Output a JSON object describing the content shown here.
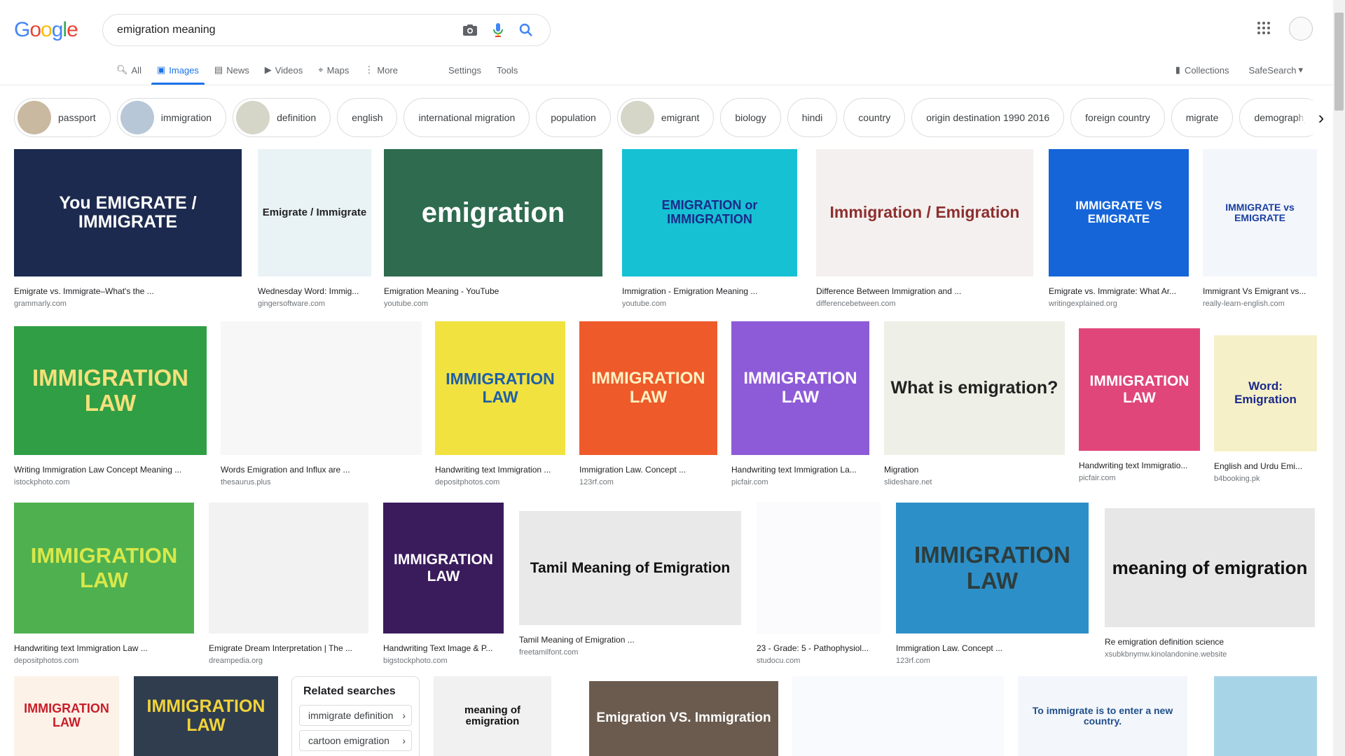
{
  "search": {
    "query": "emigration meaning"
  },
  "logo": {
    "text": "Google"
  },
  "tabs": [
    {
      "label": "All",
      "icon": "search-icon"
    },
    {
      "label": "Images",
      "icon": "image-icon",
      "active": true
    },
    {
      "label": "News",
      "icon": "news-icon"
    },
    {
      "label": "Videos",
      "icon": "video-icon"
    },
    {
      "label": "Maps",
      "icon": "map-icon"
    },
    {
      "label": "More",
      "icon": "more-vert-icon"
    }
  ],
  "tab_extras": [
    "Settings",
    "Tools"
  ],
  "right_tools": {
    "collections": "Collections",
    "safesearch": "SafeSearch"
  },
  "chips": [
    {
      "label": "passport",
      "thumb": true
    },
    {
      "label": "immigration",
      "thumb": true
    },
    {
      "label": "definition",
      "thumb": true
    },
    {
      "label": "english",
      "thumb": false
    },
    {
      "label": "international migration",
      "thumb": false
    },
    {
      "label": "population",
      "thumb": false
    },
    {
      "label": "emigrant",
      "thumb": true
    },
    {
      "label": "biology",
      "thumb": false
    },
    {
      "label": "hindi",
      "thumb": false
    },
    {
      "label": "country",
      "thumb": false
    },
    {
      "label": "origin destination 1990 2016",
      "thumb": false
    },
    {
      "label": "foreign country",
      "thumb": false
    },
    {
      "label": "migrate",
      "thumb": false
    },
    {
      "label": "demography",
      "thumb": false
    }
  ],
  "results": [
    {
      "caption": "Emigrate vs. Immigrate–What's the ...",
      "source": "grammarly.com",
      "text": "You EMIGRATE / IMMIGRATE",
      "bg": "#1d2a4f",
      "fg": "#ffffff"
    },
    {
      "caption": "Wednesday Word: Immig...",
      "source": "gingersoftware.com",
      "text": "Emigrate / Immigrate",
      "bg": "#e9f3f6",
      "fg": "#222222"
    },
    {
      "caption": "Emigration Meaning - YouTube",
      "source": "youtube.com",
      "text": "emigration",
      "bg": "#2e6b4f",
      "fg": "#ffffff"
    },
    {
      "caption": "Immigration - Emigration Meaning ...",
      "source": "youtube.com",
      "text": "EMIGRATION or IMMIGRATION",
      "bg": "#16c1d3",
      "fg": "#1a2a8a"
    },
    {
      "caption": "Difference Between Immigration and ...",
      "source": "differencebetween.com",
      "text": "Immigration / Emigration",
      "bg": "#f4f0ef",
      "fg": "#8c2f2f"
    },
    {
      "caption": "Emigrate vs. Immigrate: What Ar...",
      "source": "writingexplained.org",
      "text": "IMMIGRATE VS EMIGRATE",
      "bg": "#1565d8",
      "fg": "#ffffff"
    },
    {
      "caption": "Immigrant Vs Emigrant vs...",
      "source": "really-learn-english.com",
      "text": "IMMIGRATE vs EMIGRATE",
      "bg": "#f3f6fb",
      "fg": "#1a3fa0"
    },
    {
      "caption": "Writing Immigration Law Concept Meaning ...",
      "source": "istockphoto.com",
      "text": "IMMIGRATION LAW",
      "bg": "#2f9e45",
      "fg": "#f5e07a"
    },
    {
      "caption": "Words Emigration and Influx are ...",
      "source": "thesaurus.plus",
      "text": "",
      "bg": "#f7f7f7",
      "fg": "#333333"
    },
    {
      "caption": "Handwriting text Immigration ...",
      "source": "depositphotos.com",
      "text": "IMMIGRATION LAW",
      "bg": "#f1e23f",
      "fg": "#1d5fa7"
    },
    {
      "caption": "Immigration Law. Concept ...",
      "source": "123rf.com",
      "text": "IMMIGRATION LAW",
      "bg": "#ef5a2b",
      "fg": "#fff3c4"
    },
    {
      "caption": "Handwriting text Immigration La...",
      "source": "picfair.com",
      "text": "IMMIGRATION LAW",
      "bg": "#8e5bd8",
      "fg": "#ffffff"
    },
    {
      "caption": "Migration",
      "source": "slideshare.net",
      "text": "What is emigration?",
      "bg": "#eeefe6",
      "fg": "#222222"
    },
    {
      "caption": "Handwriting text Immigratio...",
      "source": "picfair.com",
      "text": "IMMIGRATION LAW",
      "bg": "#e0467a",
      "fg": "#ffffff"
    },
    {
      "caption": "English and Urdu Emi...",
      "source": "b4booking.pk",
      "text": "Word: Emigration",
      "bg": "#f6f0c9",
      "fg": "#1a2a8a"
    },
    {
      "caption": "Handwriting text Immigration Law ...",
      "source": "depositphotos.com",
      "text": "IMMIGRATION LAW",
      "bg": "#4fb04f",
      "fg": "#d8e84a"
    },
    {
      "caption": "Emigrate Dream Interpretation | The ...",
      "source": "dreampedia.org",
      "text": "",
      "bg": "#f2f2f2",
      "fg": "#333333"
    },
    {
      "caption": "Handwriting Text Image & P...",
      "source": "bigstockphoto.com",
      "text": "IMMIGRATION LAW",
      "bg": "#3a1b5c",
      "fg": "#ffffff"
    },
    {
      "caption": "Tamil Meaning of Emigration ...",
      "source": "freetamilfont.com",
      "text": "Tamil Meaning of Emigration",
      "bg": "#e9e9e9",
      "fg": "#111111"
    },
    {
      "caption": "23 - Grade: 5 - Pathophysiol...",
      "source": "studocu.com",
      "text": "",
      "bg": "#fbfbfd",
      "fg": "#2a3c9a"
    },
    {
      "caption": "Immigration Law. Concept ...",
      "source": "123rf.com",
      "text": "IMMIGRATION LAW",
      "bg": "#2d8fc8",
      "fg": "#2d3d3d"
    },
    {
      "caption": "Re emigration definition science",
      "source": "xsubkbnymw.kinolandonine.website",
      "text": "meaning of emigration",
      "bg": "#e7e7e7",
      "fg": "#111111"
    },
    {
      "caption": "",
      "source": "",
      "text": "IMMIGRATION LAW",
      "bg": "#fdf2e8",
      "fg": "#c81e2a"
    },
    {
      "caption": "",
      "source": "",
      "text": "IMMIGRATION LAW",
      "bg": "#2f3d4f",
      "fg": "#f1d33a"
    },
    {
      "caption": "",
      "source": "",
      "text": "meaning of emigration",
      "bg": "#f1f1f1",
      "fg": "#111111"
    },
    {
      "caption": "",
      "source": "",
      "text": "Emigration VS. Immigration",
      "bg": "#6b5b4f",
      "fg": "#ffffff"
    },
    {
      "caption": "",
      "source": "",
      "text": "",
      "bg": "#f8fafd",
      "fg": "#1a73e8"
    },
    {
      "caption": "",
      "source": "",
      "text": "To immigrate is to enter a new country.",
      "bg": "#f3f6fb",
      "fg": "#1f4f8a"
    },
    {
      "caption": "",
      "source": "",
      "text": "",
      "bg": "#a8d4e8",
      "fg": "#333333"
    }
  ],
  "related": {
    "title": "Related searches",
    "items": [
      "immigrate definition",
      "cartoon emigration"
    ]
  }
}
